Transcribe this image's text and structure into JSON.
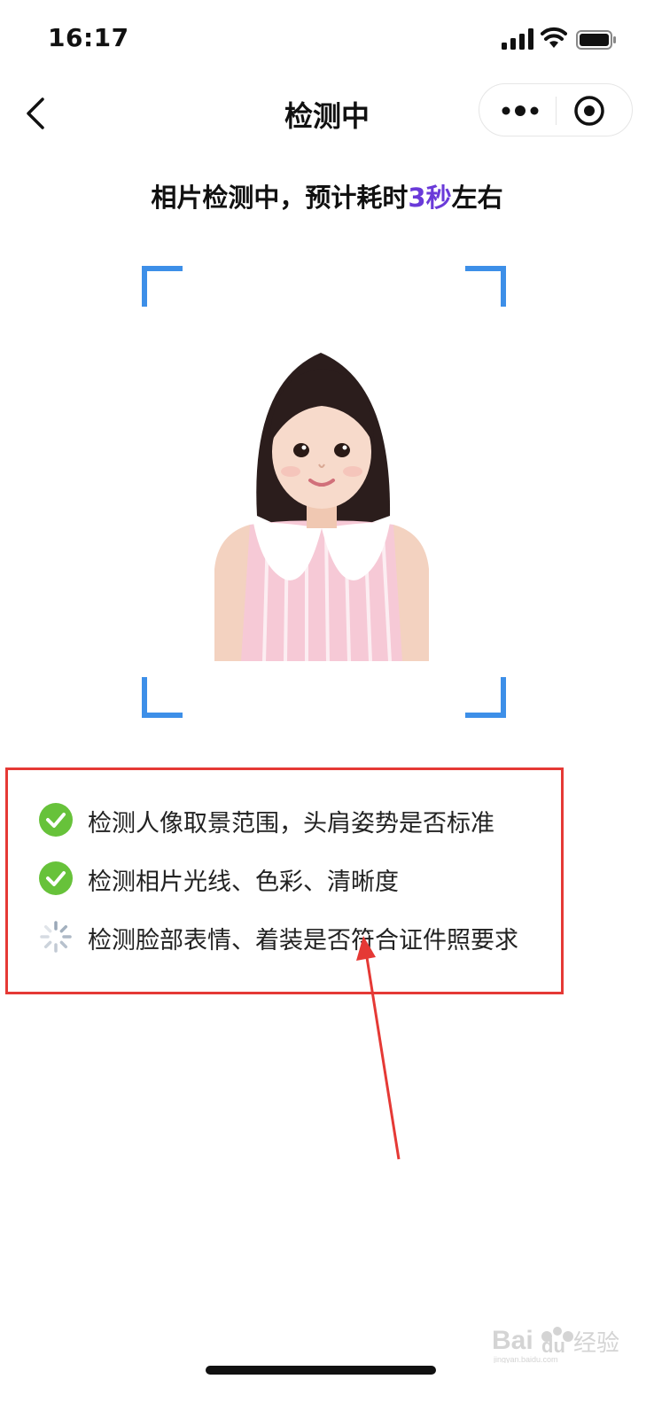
{
  "status_bar": {
    "time": "16:17"
  },
  "nav": {
    "title": "检测中"
  },
  "heading": {
    "prefix": "相片检测中，预计耗时",
    "highlight": "3秒",
    "suffix": "左右"
  },
  "checklist": [
    {
      "label": "检测人像取景范围，头肩姿势是否标准",
      "state": "done",
      "icon": "check-circle-icon"
    },
    {
      "label": "检测相片光线、色彩、清晰度",
      "state": "done",
      "icon": "check-circle-icon"
    },
    {
      "label": "检测脸部表情、着装是否符合证件照要求",
      "state": "loading",
      "icon": "loading-spinner-icon"
    }
  ],
  "colors": {
    "accent": "#6a3ad9",
    "frame": "#3d8fe8",
    "check": "#67c23a",
    "annotation": "#e53935"
  },
  "watermark": {
    "text": "Baidu经验",
    "sub": "jingyan.baidu.com"
  }
}
